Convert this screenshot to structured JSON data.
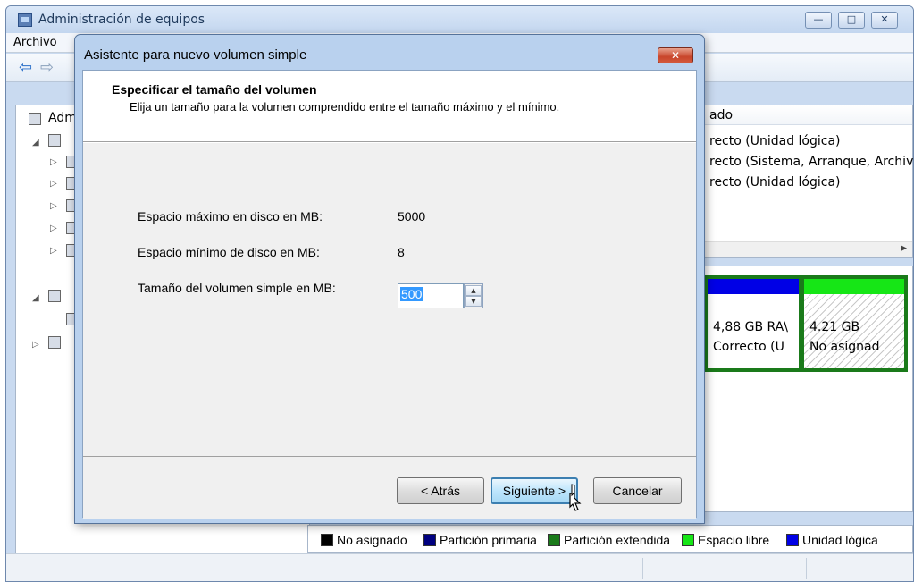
{
  "main_window": {
    "title": "Administración de equipos",
    "caption_buttons": {
      "minimize": "—",
      "maximize": "□",
      "close": "✕"
    },
    "menu": {
      "archivo": "Archivo"
    },
    "tree": {
      "root_label": "Adm"
    },
    "list": {
      "header": "ado",
      "rows": [
        "recto (Unidad lógica)",
        "recto (Sistema, Arranque, Archiv",
        "recto (Unidad lógica)"
      ]
    },
    "disk": {
      "volume1": {
        "size": "4,88 GB RA\\",
        "status": "Correcto (U"
      },
      "volume2": {
        "size": "4.21 GB",
        "status": "No asignad"
      }
    },
    "legend": [
      {
        "label": "No asignado",
        "color": "#000000"
      },
      {
        "label": "Partición primaria",
        "color": "#00007f"
      },
      {
        "label": "Partición extendida",
        "color": "#1a7a1a"
      },
      {
        "label": "Espacio libre",
        "color": "#16e616"
      },
      {
        "label": "Unidad lógica",
        "color": "#0000e6"
      }
    ]
  },
  "wizard": {
    "title": "Asistente para nuevo volumen simple",
    "close_label": "✕",
    "heading": "Especificar el tamaño del volumen",
    "subtitle": "Elija un tamaño para la volumen comprendido entre el tamaño máximo y el mínimo.",
    "fields": {
      "max_label": "Espacio máximo en disco en MB:",
      "max_value": "5000",
      "min_label": "Espacio mínimo de disco en MB:",
      "min_value": "8",
      "size_label": "Tamaño del volumen simple en MB:",
      "size_value": "500"
    },
    "buttons": {
      "back": "< Atrás",
      "next": "Siguiente >",
      "cancel": "Cancelar"
    }
  },
  "colors": {
    "accent": "#3c7fb1",
    "title_bar": "#b9d1ee",
    "selection": "#3399ff"
  }
}
